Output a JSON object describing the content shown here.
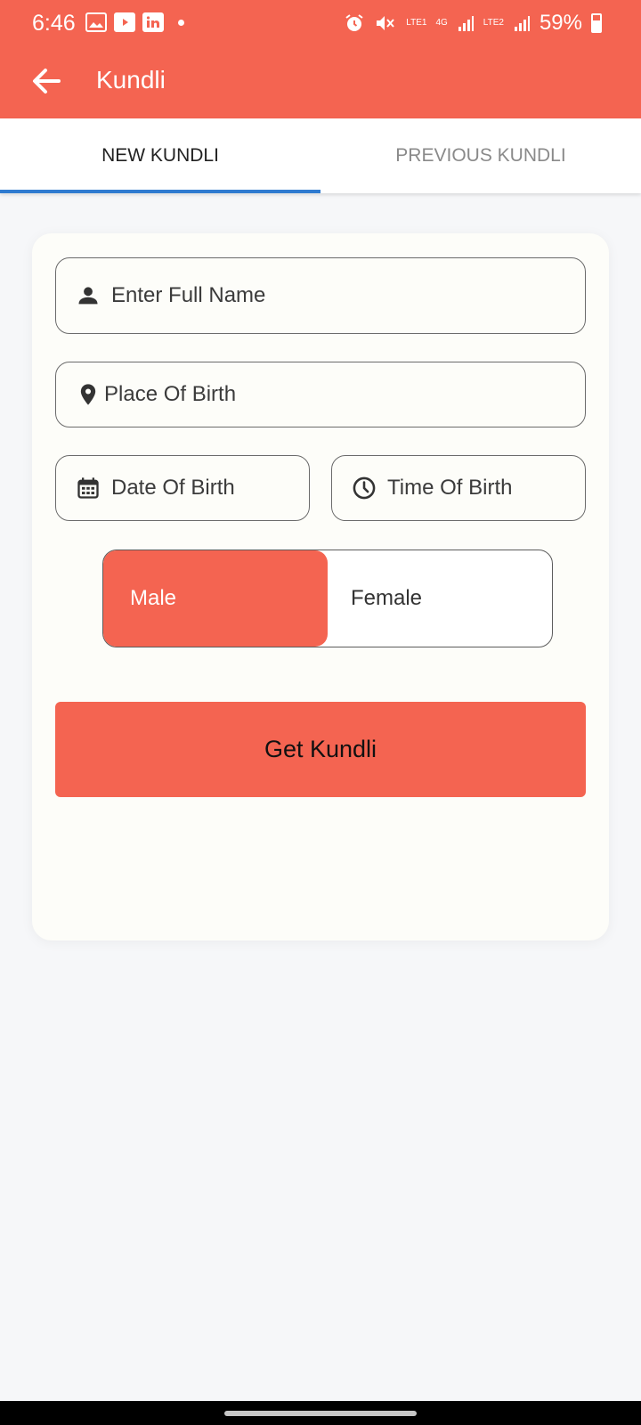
{
  "status_bar": {
    "time": "6:46",
    "battery": "59%",
    "net_1": "LTE1",
    "net_type": "4G",
    "net_2": "LTE2"
  },
  "toolbar": {
    "title": "Kundli"
  },
  "tabs": [
    {
      "label": "NEW KUNDLI",
      "selected": true
    },
    {
      "label": "PREVIOUS KUNDLI",
      "selected": false
    }
  ],
  "form": {
    "full_name_placeholder": "Enter Full Name",
    "place_placeholder": "Place Of Birth",
    "date_placeholder": "Date Of Birth",
    "time_placeholder": "Time Of Birth",
    "gender_options": [
      "Male",
      "Female"
    ],
    "gender_selected": "Male",
    "submit_label": "Get Kundli"
  },
  "colors": {
    "accent": "#f46451",
    "tab_indicator": "#2f7bd0",
    "background": "#f6f7f9"
  }
}
